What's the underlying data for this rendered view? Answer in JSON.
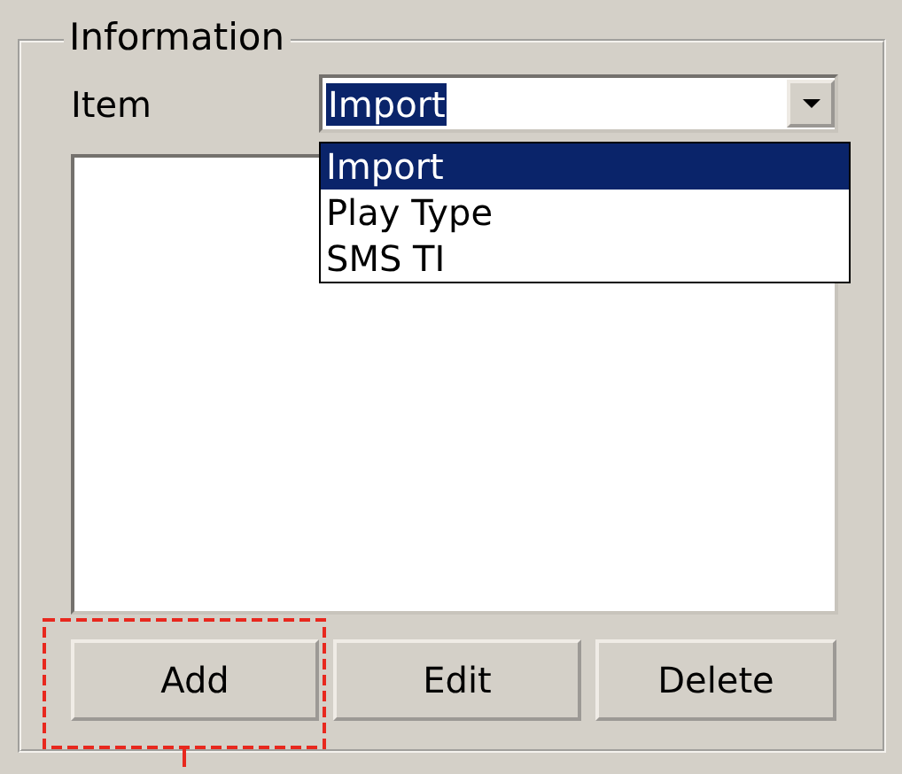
{
  "group": {
    "title": "Information"
  },
  "item": {
    "label": "Item",
    "value": "Import",
    "options": [
      {
        "label": "Import",
        "selected": true
      },
      {
        "label": "Play Type",
        "selected": false
      },
      {
        "label": "SMS TI",
        "selected": false
      }
    ]
  },
  "buttons": [
    {
      "label": "Add",
      "highlighted": true
    },
    {
      "label": "Edit",
      "highlighted": false
    },
    {
      "label": "Delete",
      "highlighted": false
    }
  ]
}
